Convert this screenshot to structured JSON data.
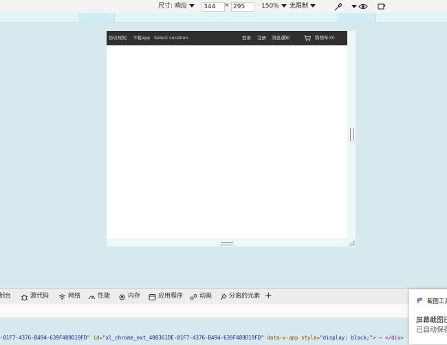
{
  "toolbar": {
    "dimensions_label": "尺寸: 响应",
    "width_value": "344",
    "times": "×",
    "height_value": "295",
    "zoom": "150%",
    "throttle": "无限制"
  },
  "site_nav": {
    "links_left": [
      "协议规则",
      "下载app",
      "Select Location"
    ],
    "links_right": [
      "登录",
      "注册",
      "消息通知"
    ],
    "cart": "购物车(0)"
  },
  "devtools_tabs": [
    {
      "label": "制台",
      "icon": "console-icon"
    },
    {
      "label": "源代码",
      "icon": "bug-icon"
    },
    {
      "label": "网络",
      "icon": "wifi-icon"
    },
    {
      "label": "性能",
      "icon": "gauge-icon"
    },
    {
      "label": "内存",
      "icon": "gear-icon"
    },
    {
      "label": "应用程序",
      "icon": "app-window-icon"
    },
    {
      "label": "动画",
      "icon": "animation-icon"
    },
    {
      "label": "分离的元素",
      "icon": "detached-elements-icon"
    }
  ],
  "add_tab": "+",
  "code_line": {
    "prefix": "-01F7-4376-B494-639F489D19FD\"",
    "attr1_name": " id=",
    "attr1_value": "\"xl_chrome_ext_408361DE-01F7-4376-B494-639F489D19FD\"",
    "attr2_name": " data-v-app style=",
    "attr2_value": "\"display: block;\"",
    "suffix": "> ⋯ </div>"
  },
  "toast": {
    "title": "截图工具",
    "heading": "屏幕截图已",
    "body": "已自动保存"
  },
  "colors": {
    "page_bg": "#d7e9ec",
    "nav_bg": "#2f2f2f",
    "toolbar_bg": "#f3f3f3"
  }
}
